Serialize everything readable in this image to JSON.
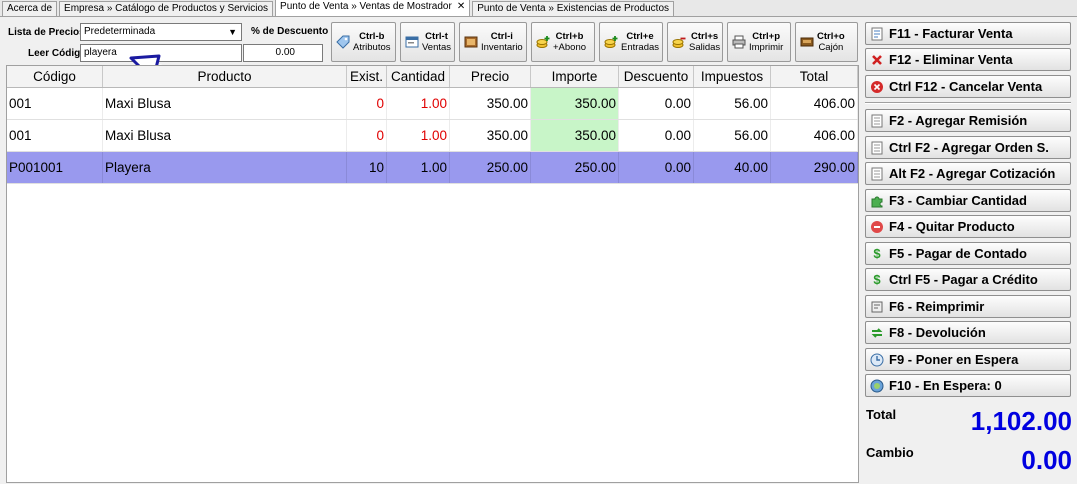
{
  "tabs": [
    {
      "label": "Acerca de",
      "active": false
    },
    {
      "label": "Empresa » Catálogo de Productos y Servicios",
      "active": false
    },
    {
      "label": "Punto de Venta » Ventas de Mostrador",
      "active": true,
      "closable": true
    },
    {
      "label": "Punto de Venta » Existencias de Productos",
      "active": false
    }
  ],
  "close_glyph": "✕",
  "form": {
    "price_list_label": "Lista de Precios",
    "price_list_value": "Predeterminada",
    "discount_label": "% de Descuento",
    "discount_value": "0.00",
    "code_label": "Leer Código",
    "code_value": "playera"
  },
  "toolbar": [
    {
      "shortcut": "Ctrl-b",
      "label": "Atributos",
      "icon": "tag-icon"
    },
    {
      "shortcut": "Ctrl-t",
      "label": "Ventas",
      "icon": "sales-window-icon"
    },
    {
      "shortcut": "Ctrl-i",
      "label": "Inventario",
      "icon": "inventory-icon"
    },
    {
      "shortcut": "Ctrl+b",
      "label": "+Abono",
      "icon": "coins-plus-icon"
    },
    {
      "shortcut": "Ctrl+e",
      "label": "Entradas",
      "icon": "coins-in-icon"
    },
    {
      "shortcut": "Ctrl+s",
      "label": "Salidas",
      "icon": "coins-out-icon"
    },
    {
      "shortcut": "Ctrl+p",
      "label": "Imprimir",
      "icon": "printer-icon"
    },
    {
      "shortcut": "Ctrl+o",
      "label": "Cajón",
      "icon": "cash-drawer-icon"
    }
  ],
  "table": {
    "columns": [
      "Código",
      "Producto",
      "Exist.",
      "Cantidad",
      "Precio",
      "Importe",
      "Descuento",
      "Impuestos",
      "Total"
    ],
    "rows": [
      {
        "codigo": "001",
        "producto": "Maxi Blusa",
        "exist": "0",
        "cantidad": "1.00",
        "precio": "350.00",
        "importe": "350.00",
        "descuento": "0.00",
        "impuestos": "56.00",
        "total": "406.00",
        "selected": false
      },
      {
        "codigo": "001",
        "producto": "Maxi Blusa",
        "exist": "0",
        "cantidad": "1.00",
        "precio": "350.00",
        "importe": "350.00",
        "descuento": "0.00",
        "impuestos": "56.00",
        "total": "406.00",
        "selected": false
      },
      {
        "codigo": "P001001",
        "producto": "Playera",
        "exist": "10",
        "cantidad": "1.00",
        "precio": "250.00",
        "importe": "250.00",
        "descuento": "0.00",
        "impuestos": "40.00",
        "total": "290.00",
        "selected": true
      }
    ]
  },
  "actions_group1": [
    {
      "label": "F11 - Facturar Venta",
      "icon": "invoice-icon"
    },
    {
      "label": "F12 - Eliminar Venta",
      "icon": "delete-x-icon"
    },
    {
      "label": "Ctrl F12 - Cancelar Venta",
      "icon": "cancel-circle-icon"
    }
  ],
  "actions_group2": [
    {
      "label": "F2 - Agregar Remisión",
      "icon": "document-icon"
    },
    {
      "label": "Ctrl F2 - Agregar Orden S.",
      "icon": "document-icon"
    },
    {
      "label": "Alt F2 - Agregar Cotización",
      "icon": "document-icon"
    },
    {
      "label": "F3 - Cambiar Cantidad",
      "icon": "puzzle-icon"
    },
    {
      "label": "F4 - Quitar Producto",
      "icon": "minus-circle-icon"
    },
    {
      "label": "F5 - Pagar de Contado",
      "icon": "dollar-icon"
    },
    {
      "label": "Ctrl F5 - Pagar a Crédito",
      "icon": "dollar-icon"
    },
    {
      "label": "F6 - Reimprimir",
      "icon": "reprint-icon"
    },
    {
      "label": "F8 - Devolución",
      "icon": "return-arrows-icon"
    },
    {
      "label": "F9 - Poner en Espera",
      "icon": "clock-icon"
    },
    {
      "label": "F10 - En Espera: 0",
      "icon": "hold-list-icon"
    }
  ],
  "totals": {
    "total_label": "Total",
    "total_value": "1,102.00",
    "change_label": "Cambio",
    "change_value": "0.00"
  },
  "colors": {
    "selected_row": "#9999ee",
    "importe_highlight": "#c8f5c8",
    "stock_zero_text": "#e00000",
    "totals_text": "#0000e0"
  }
}
